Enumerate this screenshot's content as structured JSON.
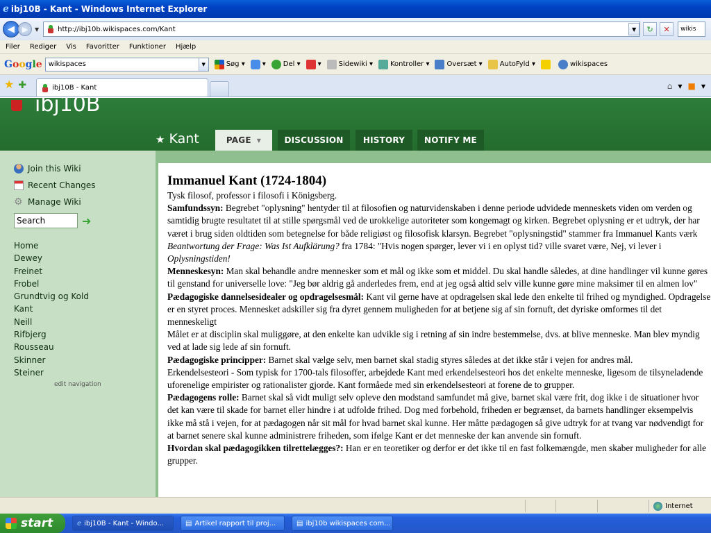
{
  "window": {
    "title": "ibj10B - Kant - Windows Internet Explorer"
  },
  "address": {
    "url": "http://ibj10b.wikispaces.com/Kant",
    "search_value": "wikis"
  },
  "menu": [
    "Filer",
    "Rediger",
    "Vis",
    "Favoritter",
    "Funktioner",
    "Hjælp"
  ],
  "google": {
    "logo": [
      "G",
      "o",
      "o",
      "g",
      "l",
      "e"
    ],
    "search_value": "wikispaces",
    "items": [
      "Søg",
      "Del",
      "Sidewiki",
      "Kontroller",
      "Oversæt",
      "AutoFyld",
      "wikispaces"
    ]
  },
  "tab": {
    "title": "ibj10B - Kant"
  },
  "site": {
    "title": "ibj10B",
    "page_name": "Kant",
    "tabs": [
      "PAGE",
      "DISCUSSION",
      "HISTORY",
      "NOTIFY ME"
    ]
  },
  "sidebar": {
    "join": "Join this Wiki",
    "recent": "Recent Changes",
    "manage": "Manage Wiki",
    "search_value": "Search",
    "nav": [
      "Home",
      "Dewey",
      "Freinet",
      "Frobel",
      "Grundtvig og Kold",
      "Kant",
      "Neill",
      "Rifbjerg",
      "Rousseau",
      "Skinner",
      "Steiner"
    ],
    "edit_nav": "edit navigation"
  },
  "content": {
    "heading": "Immanuel Kant (1724-1804)",
    "intro": "Tysk filosof, professor i filosofi i Königsberg.",
    "s1_label": "Samfundssyn:",
    "s1_text_a": " Begrebet \"oplysning\" hentyder til at filosofien og naturvidenskaben i denne periode udvidede menneskets viden om verden og samtidig brugte resultatet til at stille spørgsmål ved de urokkelige autoriteter som kongemagt og kirken. Begrebet oplysning er et udtryk, der har været i brug siden oldtiden som betegnelse for både religiøst og filosofisk klarsyn. Begrebet \"oplysningstid\" stammer fra Immanuel Kants værk ",
    "s1_italic_1": "Beantwortung der Frage: Was Ist Aufklärung?",
    "s1_text_b": " fra 1784: \"Hvis nogen spørger, lever vi i en oplyst tid? ville svaret være, Nej, vi lever i ",
    "s1_italic_2": "Oplysningstiden!",
    "s2_label": "Menneskesyn:",
    "s2_text": " Man skal behandle andre mennesker som et mål og ikke som et middel. Du skal handle således, at dine handlinger vil kunne gøres til genstand for universelle love: \"Jeg bør aldrig gå anderledes frem, end at jeg også altid selv ville kunne gøre mine maksimer til en almen lov\"",
    "s3_label": "Pædagogiske dannelsesidealer og opdragelsesmål:",
    "s3_text": " Kant vil gerne have at opdragelsen skal lede den enkelte til frihed og myndighed. Opdragelse er en styret proces. Mennesket adskiller sig fra dyret gennem muligheden for at betjene sig af sin fornuft, det dyriske omformes til det menneskeligt",
    "s3_text2": "Målet er at disciplin skal muliggøre, at den enkelte kan udvikle sig i retning af sin indre bestemmelse, dvs. at blive menneske. Man blev myndig ved at lade sig lede af sin fornuft.",
    "s4_label": "Pædagogiske principper:",
    "s4_text": " Barnet skal vælge selv, men barnet skal stadig styres således at det ikke står i vejen for andres mål.",
    "s4_text2": "Erkendelsesteori - Som typisk for 1700-tals filosoffer, arbejdede Kant med erkendelsesteori hos det enkelte menneske, ligesom de tilsyneladende uforenelige empirister og rationalister gjorde. Kant formåede med sin erkendelsesteori at forene de to grupper.",
    "s5_label": "Pædagogens rolle:",
    "s5_text": " Barnet skal så vidt muligt selv opleve den modstand samfundet må give, barnet skal være frit, dog ikke i de situationer hvor det kan være til skade for barnet eller hindre i at udfolde frihed. Dog med forbehold, friheden er begrænset, da barnets handlinger eksempelvis ikke må stå i vejen, for at pædagogen når sit mål for hvad barnet skal kunne. Her måtte pædagogen så give udtryk for at tvang var nødvendigt for at barnet senere skal kunne administrere friheden, som ifølge Kant er det menneske der kan anvende sin fornuft.",
    "s6_label": "Hvordan skal pædagogikken tilrettelægges?:",
    "s6_text": " Han er en teoretiker og derfor er det ikke til en fast folkemængde, men skaber muligheder for alle grupper."
  },
  "status": {
    "zone": "Internet"
  },
  "taskbar": {
    "start": "start",
    "items": [
      "ibj10B - Kant - Windo...",
      "Artikel rapport til proj...",
      "ibj10b wikispaces com..."
    ]
  },
  "colors": {
    "header_green": "#2e7d3a",
    "sidebar_green": "#c7dfc5",
    "tab_dark": "#1e5a25",
    "xp_blue": "#245edb"
  }
}
